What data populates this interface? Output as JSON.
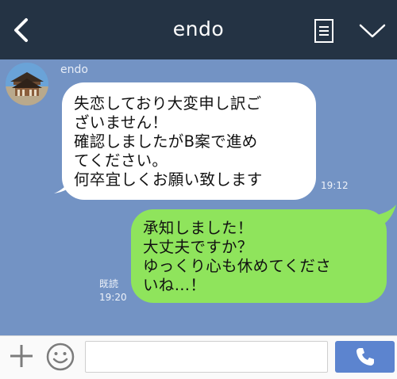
{
  "header": {
    "title": "endo",
    "back_icon": "chevron-left-icon",
    "menu_icon": "notes-list-icon",
    "dropdown_icon": "chevron-down-icon"
  },
  "messages": [
    {
      "direction": "incoming",
      "sender": "endo",
      "text": "失恋しており大変申し訳ご\nざいません！\n確認しましたがB案で進め\nてください。\n何卒宜しくお願い致します",
      "time": "19:12"
    },
    {
      "direction": "outgoing",
      "read_label": "既読",
      "text": "承知しました！\n大丈夫ですか？\nゆっくり心も休めてくださ\nいね…！",
      "time": "19:20"
    }
  ],
  "input_bar": {
    "plus_icon": "plus-icon",
    "emoji_icon": "smiley-icon",
    "message_value": "",
    "call_icon": "phone-icon"
  },
  "colors": {
    "header_bg": "#243344",
    "chat_bg": "#7393c4",
    "incoming_bubble": "#ffffff",
    "outgoing_bubble": "#8fe45c",
    "call_button": "#5c84cf"
  }
}
